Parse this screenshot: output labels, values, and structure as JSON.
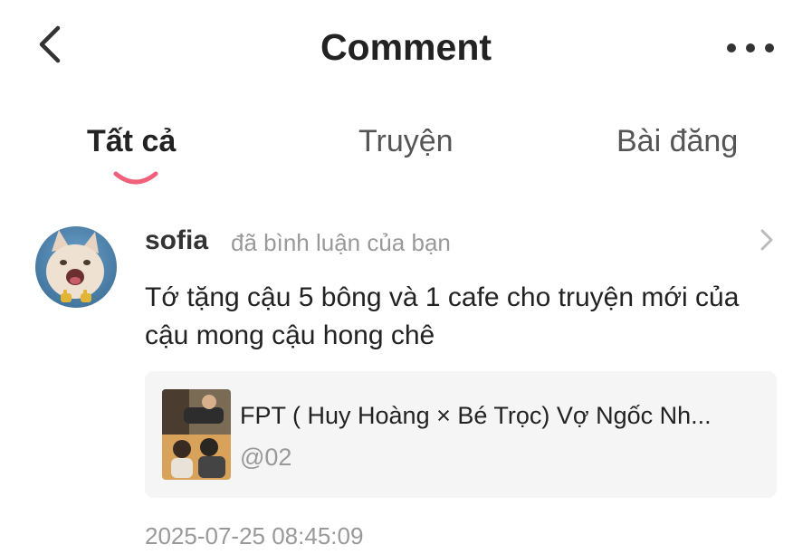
{
  "header": {
    "title": "Comment",
    "back_icon": "chevron-left-icon",
    "more_icon": "more-horizontal-icon"
  },
  "tabs": [
    {
      "label": "Tất cả",
      "active": true
    },
    {
      "label": "Truyện",
      "active": false
    },
    {
      "label": "Bài đăng",
      "active": false
    }
  ],
  "colors": {
    "accent": "#f0607a",
    "muted": "#999999",
    "card_bg": "#f5f5f5"
  },
  "comment": {
    "username": "sofia",
    "action": "đã bình luận của bạn",
    "text": "Tớ tặng cậu 5 bông và 1 cafe cho truyện mới của cậu mong cậu hong chê",
    "story": {
      "title": "FPT ( Huy Hoàng × Bé Trọc) Vợ Ngốc Nh...",
      "chapter": "@02"
    },
    "timestamp": "2025-07-25 08:45:09"
  }
}
